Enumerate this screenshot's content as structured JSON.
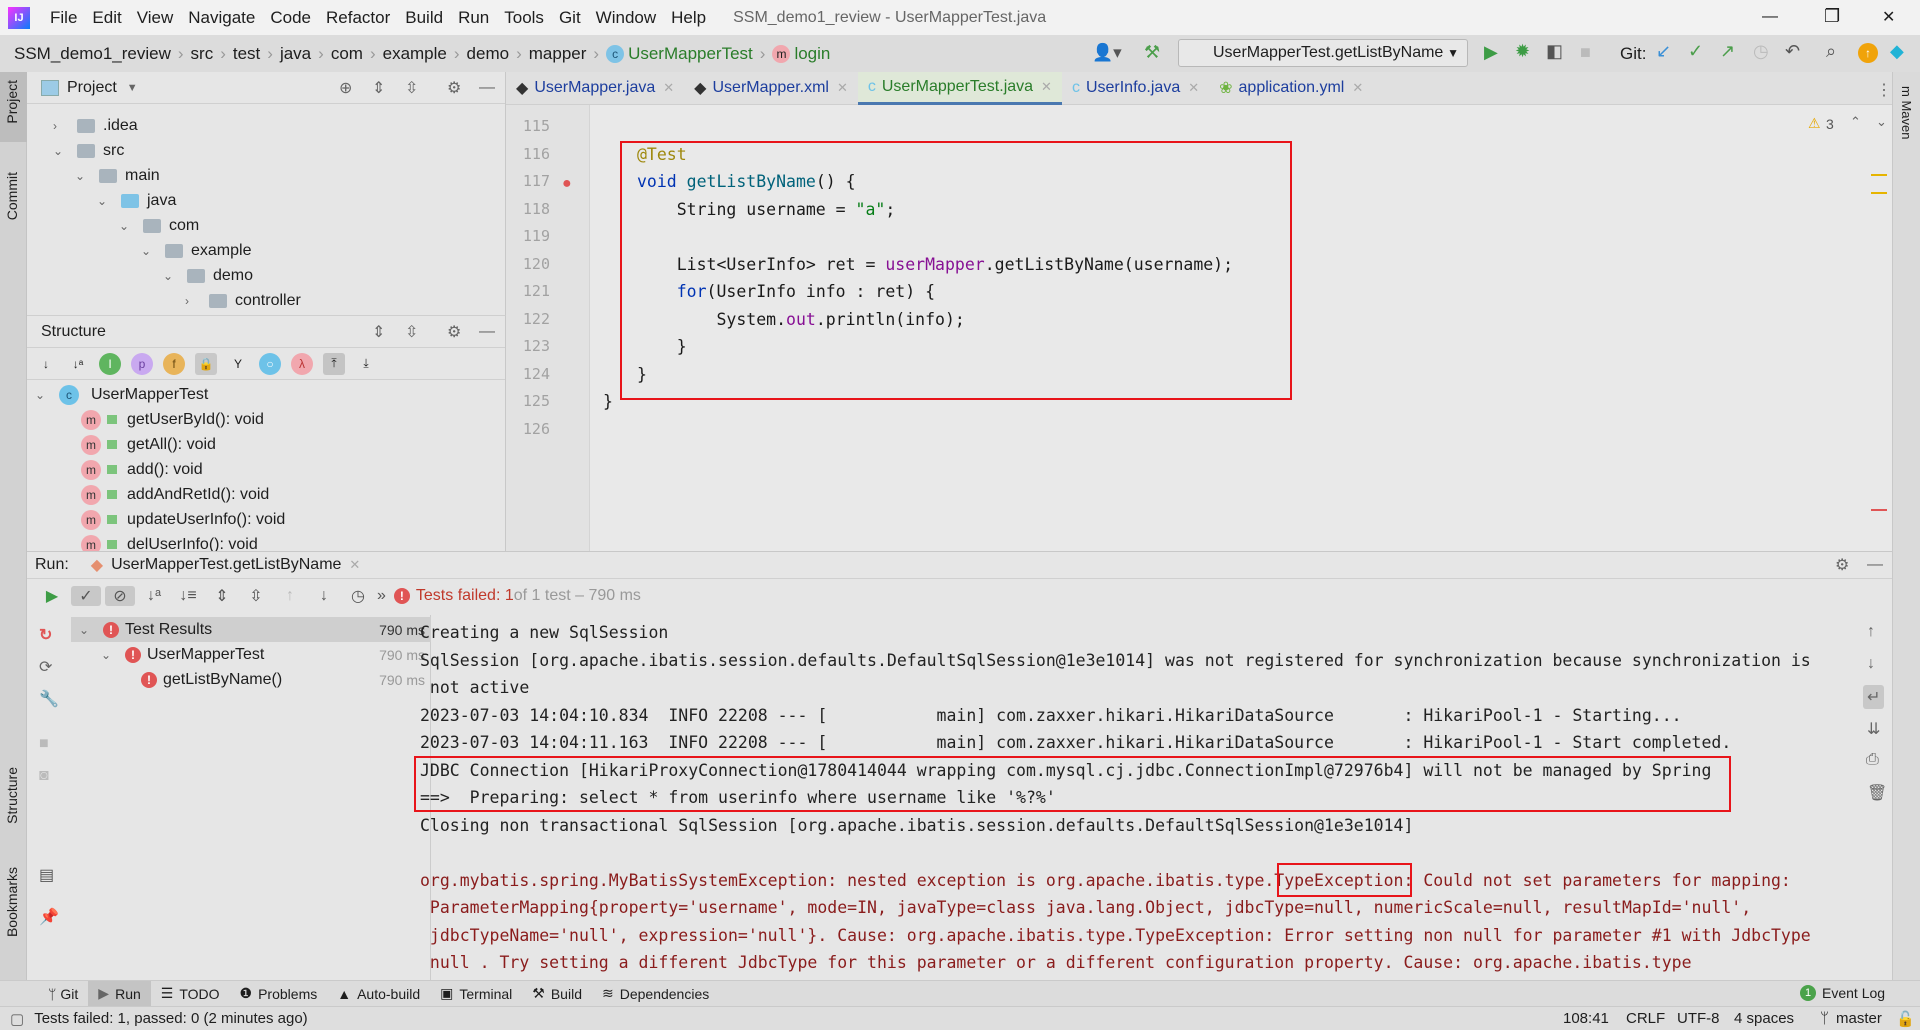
{
  "title_bar": {
    "menu": [
      "File",
      "Edit",
      "View",
      "Navigate",
      "Code",
      "Refactor",
      "Build",
      "Run",
      "Tools",
      "Git",
      "Window",
      "Help"
    ],
    "window_title": "SSM_demo1_review - UserMapperTest.java",
    "controls": [
      "—",
      "❐",
      "✕"
    ]
  },
  "breadcrumb": {
    "items": [
      "SSM_demo1_review",
      "src",
      "test",
      "java",
      "com",
      "example",
      "demo",
      "mapper",
      "UserMapperTest",
      "login"
    ],
    "run_config": "UserMapperTest.getListByName",
    "git_label": "Git:"
  },
  "left_strip": {
    "project": "Project",
    "commit": "Commit",
    "structure": "Structure",
    "bookmarks": "Bookmarks"
  },
  "project_panel": {
    "title": "Project",
    "tree": [
      {
        "label": ".idea",
        "depth": 0,
        "expanded": false
      },
      {
        "label": "src",
        "depth": 0,
        "expanded": true
      },
      {
        "label": "main",
        "depth": 1,
        "expanded": true
      },
      {
        "label": "java",
        "depth": 2,
        "expanded": true
      },
      {
        "label": "com",
        "depth": 3,
        "expanded": true
      },
      {
        "label": "example",
        "depth": 4,
        "expanded": true
      },
      {
        "label": "demo",
        "depth": 5,
        "expanded": true
      },
      {
        "label": "controller",
        "depth": 6,
        "expanded": false
      }
    ]
  },
  "structure_panel": {
    "title": "Structure",
    "class_name": "UserMapperTest",
    "methods": [
      "getUserById(): void",
      "getAll(): void",
      "add(): void",
      "addAndRetId(): void",
      "updateUserInfo(): void",
      "delUserInfo(): void"
    ]
  },
  "editor": {
    "tabs": [
      {
        "label": "UserMapper.java",
        "active": false
      },
      {
        "label": "UserMapper.xml",
        "active": false
      },
      {
        "label": "UserMapperTest.java",
        "active": true
      },
      {
        "label": "UserInfo.java",
        "active": false
      },
      {
        "label": "application.yml",
        "active": false
      }
    ],
    "warnings_count": "3",
    "line_numbers": [
      "115",
      "116",
      "117",
      "118",
      "119",
      "120",
      "121",
      "122",
      "123",
      "124",
      "125",
      "126"
    ],
    "lines": [
      [],
      [
        {
          "t": "@Test",
          "c": "#9e880d"
        }
      ],
      [
        {
          "t": "void ",
          "c": "#0033b3"
        },
        {
          "t": "getListByName",
          "c": "#00627a"
        },
        {
          "t": "() {",
          "c": "#1a1a1a"
        }
      ],
      [
        {
          "t": "    String username = ",
          "c": "#1a1a1a"
        },
        {
          "t": "\"a\"",
          "c": "#067d17"
        },
        {
          "t": ";",
          "c": "#1a1a1a"
        }
      ],
      [],
      [
        {
          "t": "    List<UserInfo> ret = ",
          "c": "#1a1a1a"
        },
        {
          "t": "userMapper",
          "c": "#871094"
        },
        {
          "t": ".getListByName(username);",
          "c": "#1a1a1a"
        }
      ],
      [
        {
          "t": "    for",
          "c": "#0033b3"
        },
        {
          "t": "(UserInfo info : ret) {",
          "c": "#1a1a1a"
        }
      ],
      [
        {
          "t": "        System.",
          "c": "#1a1a1a"
        },
        {
          "t": "out",
          "c": "#871094"
        },
        {
          "t": ".println(info);",
          "c": "#1a1a1a"
        }
      ],
      [
        {
          "t": "    }",
          "c": "#1a1a1a"
        }
      ],
      [
        {
          "t": "}",
          "c": "#1a1a1a"
        }
      ],
      [
        {
          "t": "}",
          "c": "#1a1a1a",
          "outdent": true
        }
      ],
      []
    ]
  },
  "run_panel": {
    "label": "Run:",
    "tab": "UserMapperTest.getListByName",
    "status_prefix": "Tests failed: 1",
    "status_suffix": " of 1 test – 790 ms",
    "tree": [
      {
        "label": "Test Results",
        "time": "790 ms"
      },
      {
        "label": "UserMapperTest",
        "time": "790 ms"
      },
      {
        "label": "getListByName()",
        "time": "790 ms"
      }
    ],
    "console": [
      {
        "text": "Creating a new SqlSession",
        "type": "normal"
      },
      {
        "text": "SqlSession [org.apache.ibatis.session.defaults.DefaultSqlSession@1e3e1014] was not registered for synchronization because synchronization is",
        "type": "normal"
      },
      {
        "text": " not active",
        "type": "normal"
      },
      {
        "text": "2023-07-03 14:04:10.834  INFO 22208 --- [           main] com.zaxxer.hikari.HikariDataSource       : HikariPool-1 - Starting...",
        "type": "normal"
      },
      {
        "text": "2023-07-03 14:04:11.163  INFO 22208 --- [           main] com.zaxxer.hikari.HikariDataSource       : HikariPool-1 - Start completed.",
        "type": "normal"
      },
      {
        "text": "JDBC Connection [HikariProxyConnection@1780414044 wrapping com.mysql.cj.jdbc.ConnectionImpl@72976b4] will not be managed by Spring",
        "type": "normal"
      },
      {
        "text": "==>  Preparing: select * from userinfo where username like '%?%'",
        "type": "normal"
      },
      {
        "text": "Closing non transactional SqlSession [org.apache.ibatis.session.defaults.DefaultSqlSession@1e3e1014]",
        "type": "normal"
      },
      {
        "text": "",
        "type": "normal"
      },
      {
        "text": "org.mybatis.spring.MyBatisSystemException: nested exception is org.apache.ibatis.type.TypeException: Could not set parameters for mapping:",
        "type": "error"
      },
      {
        "text": " ParameterMapping{property='username', mode=IN, javaType=class java.lang.Object, jdbcType=null, numericScale=null, resultMapId='null',",
        "type": "error"
      },
      {
        "text": " jdbcTypeName='null', expression='null'}. Cause: org.apache.ibatis.type.TypeException: Error setting non null for parameter #1 with JdbcType",
        "type": "error"
      },
      {
        "text": " null . Try setting a different JdbcType for this parameter or a different configuration property. Cause: org.apache.ibatis.type",
        "type": "error"
      }
    ]
  },
  "bottom_toolbar": {
    "items": [
      "Git",
      "Run",
      "TODO",
      "Problems",
      "Auto-build",
      "Terminal",
      "Build",
      "Dependencies"
    ],
    "event_log": "Event Log",
    "event_log_count": "1"
  },
  "status_bar": {
    "message": "Tests failed: 1, passed: 0 (2 minutes ago)",
    "position": "108:41",
    "line_ending": "CRLF",
    "encoding": "UTF-8",
    "indent": "4 spaces",
    "branch": "master"
  },
  "colors": {
    "error_red": "#e05555",
    "annotation_box": "#e8141a",
    "exception_text": "#8a1c1c",
    "active_tab_underline": "#4a78b0"
  }
}
